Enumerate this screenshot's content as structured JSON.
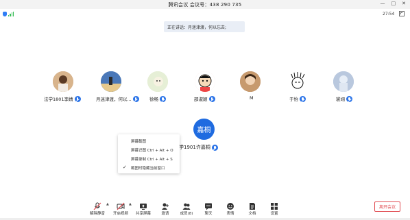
{
  "window": {
    "title": "腾讯会议  会议号：438 290 735",
    "controls": {
      "minimize": "—",
      "maximize": "□",
      "close": "✕"
    }
  },
  "status": {
    "time": "27:54",
    "shield_icon": "shield-icon",
    "signal_icon": "signal-icon"
  },
  "speaking_banner": "正在讲话：月迷津渡，何以忘去;",
  "participants": [
    {
      "name": "法学1801李婧",
      "avatar_color": "#caa27a"
    },
    {
      "name": "月迷津渡，何以...",
      "avatar_color": "#3d6aa8"
    },
    {
      "name": "徐畅",
      "avatar_color": "#dfe9cf"
    },
    {
      "name": "邵淑颖",
      "avatar_color": "#f4c9c9"
    },
    {
      "name": "M",
      "avatar_color": "#b08058"
    },
    {
      "name": "于怡",
      "avatar_color": "#ffffff"
    },
    {
      "name": "裳翊",
      "avatar_color": "#aabbd6"
    }
  ],
  "main_participant": {
    "avatar_text": "嘉桐",
    "name": "法学1901许嘉桐"
  },
  "context_menu": {
    "items": [
      {
        "label": "屏幕截图",
        "checked": false
      },
      {
        "label": "屏幕识图  Ctrl + Alt + O",
        "checked": false
      },
      {
        "label": "屏幕录制  Ctrl + Alt + S",
        "checked": false
      },
      {
        "label": "截图时隐藏当前窗口",
        "checked": true
      }
    ]
  },
  "toolbar": {
    "unmute": "解除静音",
    "start_video": "开启视频",
    "share_screen": "共享屏幕",
    "invite": "邀请",
    "members": "成员(8)",
    "chat": "聊天",
    "reactions": "表情",
    "documents": "文档",
    "settings": "设置",
    "leave": "离开会议"
  },
  "colors": {
    "accent": "#2a73e8",
    "leave": "#e0484e",
    "banner": "#e9eef6"
  }
}
